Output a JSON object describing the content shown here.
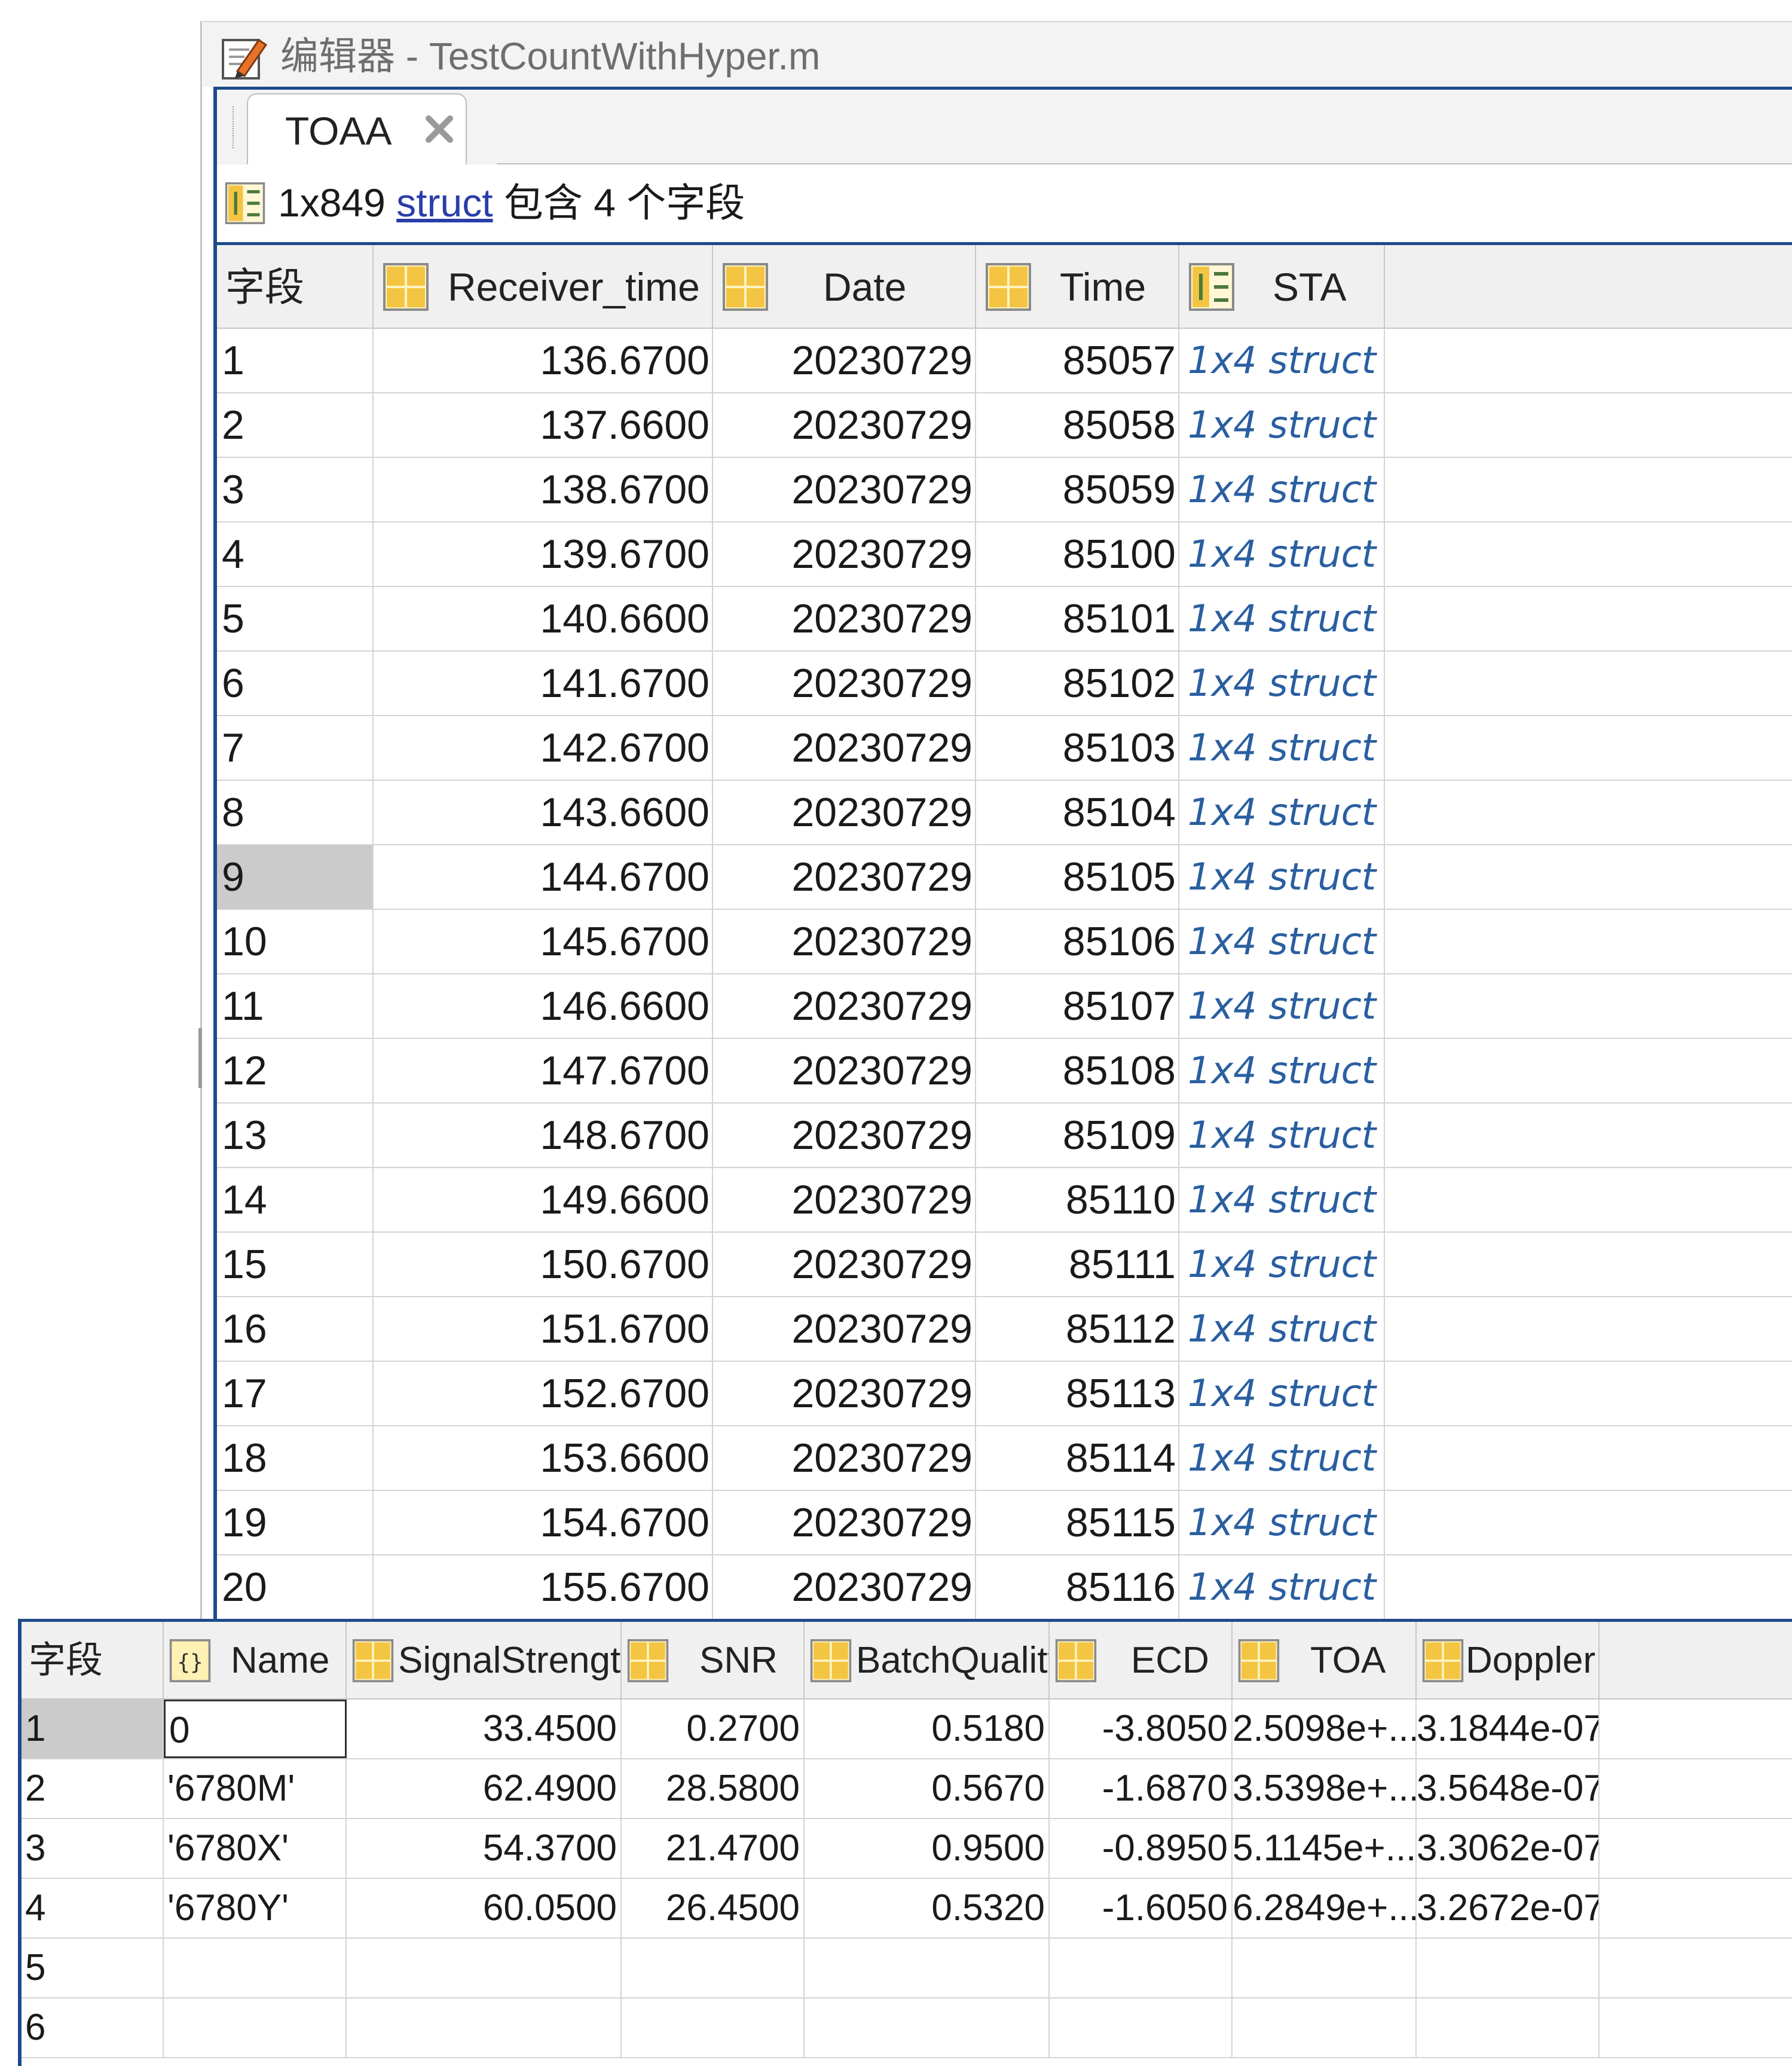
{
  "window": {
    "title": "编辑器 - TestCountWithHyper.m"
  },
  "tab": {
    "label": "TOAA"
  },
  "info": {
    "size": "1x849",
    "type_link": "struct",
    "suffix": "包含 4 个字段"
  },
  "main_table": {
    "headers": {
      "field": "字段",
      "receiver_time": "Receiver_time",
      "date": "Date",
      "time": "Time",
      "sta": "STA"
    },
    "rows": [
      {
        "idx": "1",
        "receiver_time": "136.6700",
        "date": "20230729",
        "time": "85057",
        "sta": "1x4 struct"
      },
      {
        "idx": "2",
        "receiver_time": "137.6600",
        "date": "20230729",
        "time": "85058",
        "sta": "1x4 struct"
      },
      {
        "idx": "3",
        "receiver_time": "138.6700",
        "date": "20230729",
        "time": "85059",
        "sta": "1x4 struct"
      },
      {
        "idx": "4",
        "receiver_time": "139.6700",
        "date": "20230729",
        "time": "85100",
        "sta": "1x4 struct"
      },
      {
        "idx": "5",
        "receiver_time": "140.6600",
        "date": "20230729",
        "time": "85101",
        "sta": "1x4 struct"
      },
      {
        "idx": "6",
        "receiver_time": "141.6700",
        "date": "20230729",
        "time": "85102",
        "sta": "1x4 struct"
      },
      {
        "idx": "7",
        "receiver_time": "142.6700",
        "date": "20230729",
        "time": "85103",
        "sta": "1x4 struct"
      },
      {
        "idx": "8",
        "receiver_time": "143.6600",
        "date": "20230729",
        "time": "85104",
        "sta": "1x4 struct"
      },
      {
        "idx": "9",
        "receiver_time": "144.6700",
        "date": "20230729",
        "time": "85105",
        "sta": "1x4 struct"
      },
      {
        "idx": "10",
        "receiver_time": "145.6700",
        "date": "20230729",
        "time": "85106",
        "sta": "1x4 struct"
      },
      {
        "idx": "11",
        "receiver_time": "146.6600",
        "date": "20230729",
        "time": "85107",
        "sta": "1x4 struct"
      },
      {
        "idx": "12",
        "receiver_time": "147.6700",
        "date": "20230729",
        "time": "85108",
        "sta": "1x4 struct"
      },
      {
        "idx": "13",
        "receiver_time": "148.6700",
        "date": "20230729",
        "time": "85109",
        "sta": "1x4 struct"
      },
      {
        "idx": "14",
        "receiver_time": "149.6600",
        "date": "20230729",
        "time": "85110",
        "sta": "1x4 struct"
      },
      {
        "idx": "15",
        "receiver_time": "150.6700",
        "date": "20230729",
        "time": "85111",
        "sta": "1x4 struct"
      },
      {
        "idx": "16",
        "receiver_time": "151.6700",
        "date": "20230729",
        "time": "85112",
        "sta": "1x4 struct"
      },
      {
        "idx": "17",
        "receiver_time": "152.6700",
        "date": "20230729",
        "time": "85113",
        "sta": "1x4 struct"
      },
      {
        "idx": "18",
        "receiver_time": "153.6600",
        "date": "20230729",
        "time": "85114",
        "sta": "1x4 struct"
      },
      {
        "idx": "19",
        "receiver_time": "154.6700",
        "date": "20230729",
        "time": "85115",
        "sta": "1x4 struct"
      },
      {
        "idx": "20",
        "receiver_time": "155.6700",
        "date": "20230729",
        "time": "85116",
        "sta": "1x4 struct"
      }
    ]
  },
  "sta_table": {
    "headers": {
      "field": "字段",
      "name": "Name",
      "signal_strength": "SignalStrengtl",
      "snr": "SNR",
      "batch_quality": "BatchQuality",
      "ecd": "ECD",
      "toa": "TOA",
      "doppler": "Doppler"
    },
    "rows": [
      {
        "idx": "1",
        "name": "0",
        "signal_strength": "33.4500",
        "snr": "0.2700",
        "batch_quality": "0.5180",
        "ecd": "-3.8050",
        "toa": "2.5098e+...",
        "doppler": "3.1844e-07"
      },
      {
        "idx": "2",
        "name": "'6780M'",
        "signal_strength": "62.4900",
        "snr": "28.5800",
        "batch_quality": "0.5670",
        "ecd": "-1.6870",
        "toa": "3.5398e+...",
        "doppler": "3.5648e-07"
      },
      {
        "idx": "3",
        "name": "'6780X'",
        "signal_strength": "54.3700",
        "snr": "21.4700",
        "batch_quality": "0.9500",
        "ecd": "-0.8950",
        "toa": "5.1145e+...",
        "doppler": "3.3062e-07"
      },
      {
        "idx": "4",
        "name": "'6780Y'",
        "signal_strength": "60.0500",
        "snr": "26.4500",
        "batch_quality": "0.5320",
        "ecd": "-1.6050",
        "toa": "6.2849e+...",
        "doppler": "3.2672e-07"
      },
      {
        "idx": "5",
        "name": "",
        "signal_strength": "",
        "snr": "",
        "batch_quality": "",
        "ecd": "",
        "toa": "",
        "doppler": ""
      },
      {
        "idx": "6",
        "name": "",
        "signal_strength": "",
        "snr": "",
        "batch_quality": "",
        "ecd": "",
        "toa": "",
        "doppler": ""
      }
    ]
  },
  "icons": {
    "title": "editor-pencil-icon",
    "close": "close-icon",
    "struct": "struct-field-icon",
    "matrix": "matrix-icon",
    "cell": "cell-array-icon"
  },
  "colors": {
    "accent": "#1e4a8c",
    "link": "#2a3ea8",
    "struct_value": "#2a5fa0",
    "selected_row": "#cbcbcb"
  }
}
